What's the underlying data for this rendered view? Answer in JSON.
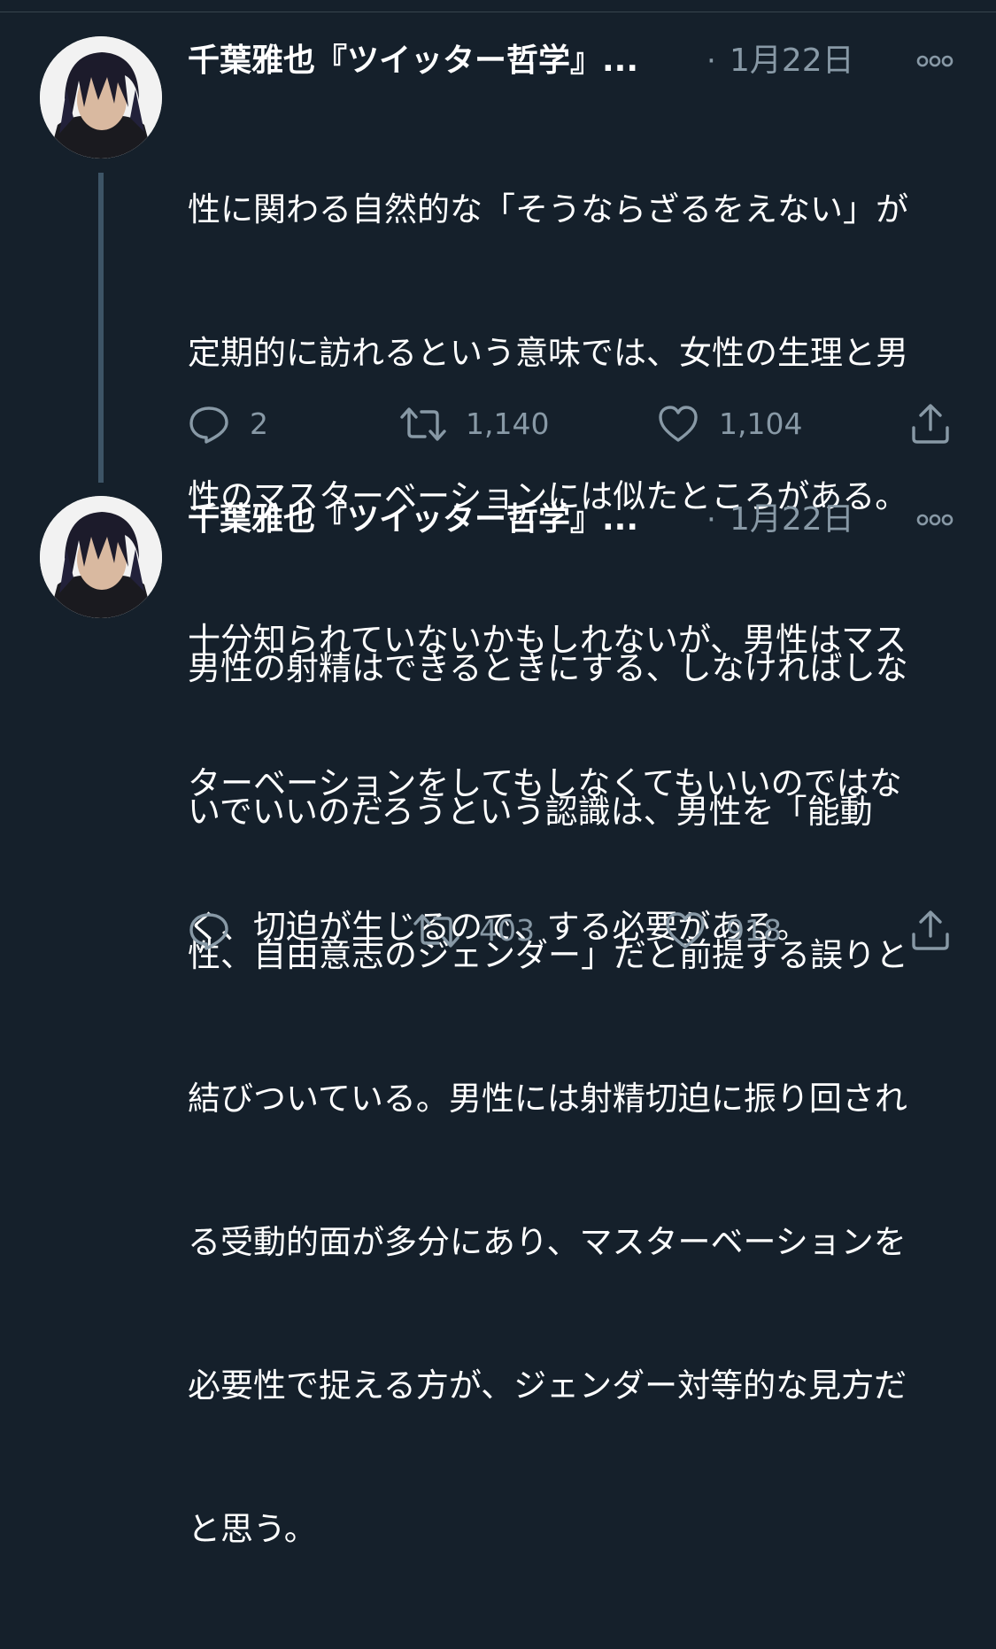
{
  "tweets": [
    {
      "display_name": "千葉雅也『ツイッター哲学』...",
      "separator": "·",
      "timestamp": "1月22日",
      "text_lines": [
        "性に関わる自然的な「そうならざるをえない」が",
        "定期的に訪れるという意味では、女性の生理と男",
        "性のマスターベーションには似たところがある。",
        "十分知られていないかもしれないが、男性はマス",
        "ターベーションをしてもしなくてもいいのではな",
        "く、切迫が生じるので、する必要がある。"
      ],
      "reply_count": "2",
      "retweet_count": "1,140",
      "like_count": "1,104"
    },
    {
      "display_name": "千葉雅也『ツイッター哲学』...",
      "separator": "·",
      "timestamp": "1月22日",
      "text_lines": [
        "男性の射精はできるときにする、しなければしな",
        "いでいいのだろうという認識は、男性を「能動",
        "性、自由意志のジェンダー」だと前提する誤りと",
        "結びついている。男性には射精切迫に振り回され",
        "る受動的面が多分にあり、マスターベーションを",
        "必要性で捉える方が、ジェンダー対等的な見方だ",
        "と思う。"
      ],
      "reply_count": "",
      "retweet_count": "403",
      "like_count": "918"
    }
  ],
  "icons": {
    "more": "more-horizontal-icon",
    "reply": "reply-bubble-icon",
    "retweet": "retweet-icon",
    "like": "heart-icon",
    "share": "share-icon"
  },
  "colors": {
    "background": "#15202b",
    "text_primary": "#ffffff",
    "text_secondary": "#8899a6",
    "thread_line": "#3d5466",
    "divider": "#38444d"
  }
}
